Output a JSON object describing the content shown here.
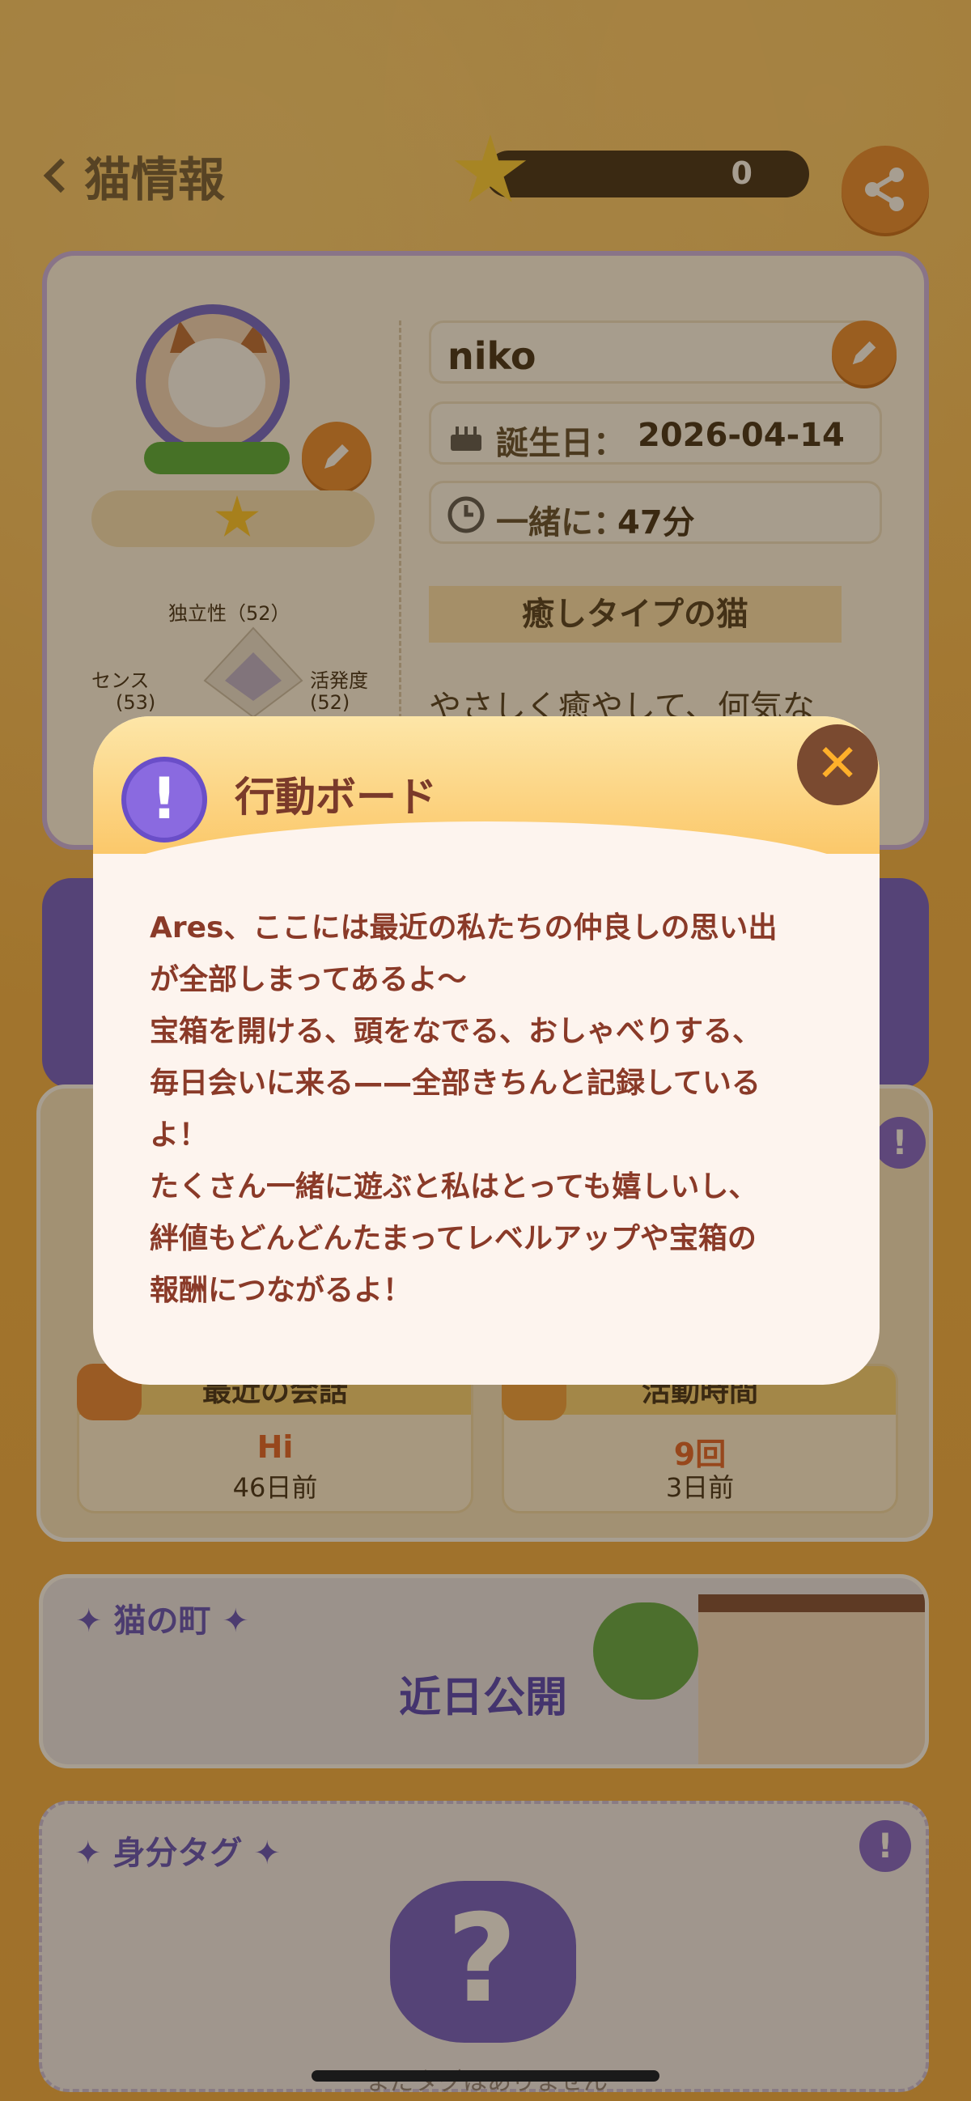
{
  "header": {
    "title": "猫情報",
    "star_count": "0"
  },
  "profile": {
    "name": "niko",
    "birthday_label": "誕生日：",
    "birthday_value": "2026-04-14",
    "together_label": "一緒に：",
    "together_value": "47分",
    "type_title": "癒しタイプの猫",
    "description": "やさしく癒やして、何気な",
    "radar": {
      "top": "独立性（52）",
      "left_name": "センス",
      "left_val": "(53)",
      "right_name": "活発度",
      "right_val": "(52)"
    }
  },
  "stats": [
    {
      "title": "最近の会話",
      "value": "Hi",
      "sub": "46日前"
    },
    {
      "title": "活動時間",
      "value": "9回",
      "sub": "3日前"
    }
  ],
  "town": {
    "title": "✦ 猫の町 ✦",
    "soon": "近日公開"
  },
  "tags": {
    "title": "✦ 身分タグ ✦",
    "empty": "まだタグはありません"
  },
  "modal": {
    "title": "行動ボード",
    "close_glyph": "✕",
    "info_glyph": "!",
    "lines": [
      "Ares、ここには最近の私たちの仲良しの思い出",
      "が全部しまってあるよ〜",
      "宝箱を開ける、頭をなでる、おしゃべりする、",
      "毎日会いに来る——全部きちんと記録している",
      "よ！",
      "たくさん一緒に遊ぶと私はとっても嬉しいし、",
      "絆値もどんどんたまってレベルアップや宝箱の",
      "報酬につながるよ！"
    ]
  }
}
